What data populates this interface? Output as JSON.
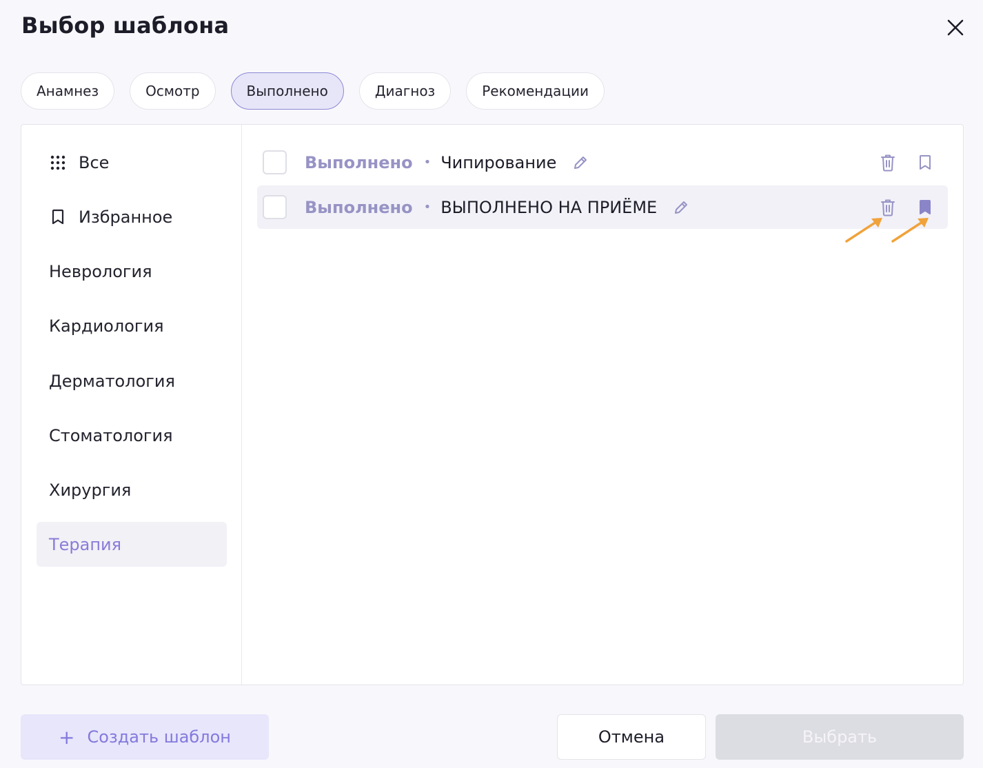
{
  "header": {
    "title": "Выбор шаблона"
  },
  "tabs": [
    {
      "label": "Анамнез",
      "active": false
    },
    {
      "label": "Осмотр",
      "active": false
    },
    {
      "label": "Выполнено",
      "active": true
    },
    {
      "label": "Диагноз",
      "active": false
    },
    {
      "label": "Рекомендации",
      "active": false
    }
  ],
  "sidebar": {
    "items": [
      {
        "label": "Все",
        "icon": "grid-icon"
      },
      {
        "label": "Избранное",
        "icon": "bookmark-icon"
      },
      {
        "label": "Неврология"
      },
      {
        "label": "Кардиология"
      },
      {
        "label": "Дерматология"
      },
      {
        "label": "Стоматология"
      },
      {
        "label": "Хирургия"
      },
      {
        "label": "Терапия",
        "active": true
      }
    ]
  },
  "templates": [
    {
      "category": "Выполнено",
      "separator": "•",
      "name": "Чипирование",
      "favorite": false,
      "checked": false
    },
    {
      "category": "Выполнено",
      "separator": "•",
      "name": "ВЫПОЛНЕНО НА ПРИЁМЕ",
      "favorite": true,
      "checked": false
    }
  ],
  "footer": {
    "create_plus": "+",
    "create_label": "Создать шаблон",
    "cancel_label": "Отмена",
    "select_label": "Выбрать"
  },
  "colors": {
    "accent": "#8a7bd9",
    "active_tab_bg": "#e7e6f8",
    "annotation_arrow": "#f0a23b",
    "disabled_button": "#dcdce3"
  }
}
